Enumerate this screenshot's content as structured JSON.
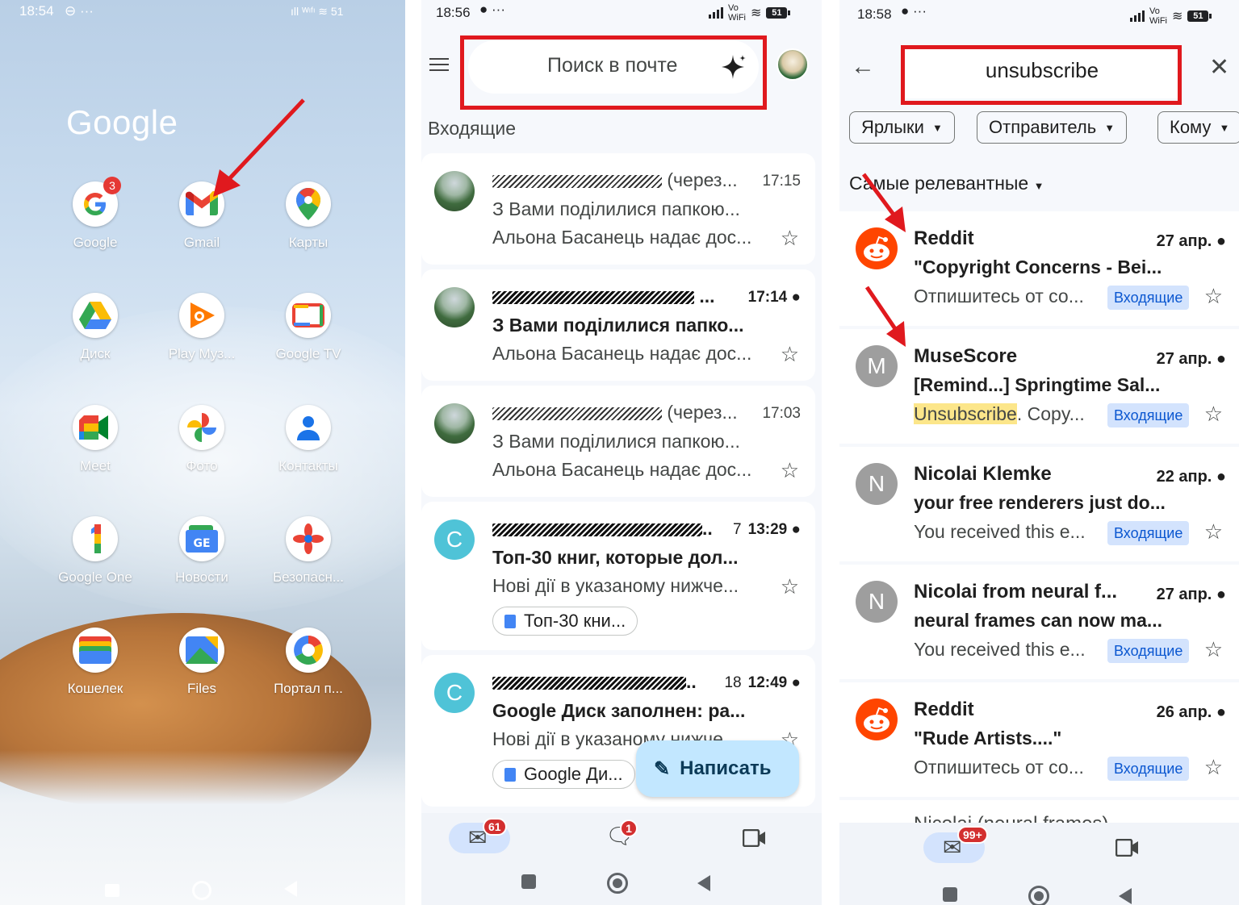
{
  "panel1": {
    "status_time": "18:54",
    "status_dots": "⊖ ···",
    "status_right": "ıll ᵂᶦᶠᶦ ≋ 51",
    "folder_title": "Google",
    "apps": [
      {
        "label": "Google",
        "badge": "3"
      },
      {
        "label": "Gmail"
      },
      {
        "label": "Карты"
      },
      {
        "label": "Диск"
      },
      {
        "label": "Play Муз..."
      },
      {
        "label": "Google TV"
      },
      {
        "label": "Meet"
      },
      {
        "label": "Фото"
      },
      {
        "label": "Контакты"
      },
      {
        "label": "Google One"
      },
      {
        "label": "Новости"
      },
      {
        "label": "Безопасн..."
      },
      {
        "label": "Кошелек"
      },
      {
        "label": "Files"
      },
      {
        "label": "Портал п..."
      }
    ]
  },
  "panel2": {
    "status_time": "18:56",
    "search_placeholder": "Поиск в почте",
    "section_title": "Входящие",
    "emails": [
      {
        "from_suffix": "(через...",
        "time": "17:15",
        "subject": "З Вами поділилися папкою...",
        "snippet": "Альона Басанець надає дос...",
        "unread": false
      },
      {
        "from_suffix": "...",
        "time": "17:14",
        "subject": "З Вами поділилися папко...",
        "snippet": "Альона Басанець надає дос...",
        "unread": true
      },
      {
        "from_suffix": "(через...",
        "time": "17:03",
        "subject": "З Вами поділилися папкою...",
        "snippet": "Альона Басанець надає дос...",
        "unread": false
      },
      {
        "from_suffix": "..",
        "count": "7",
        "time": "13:29",
        "subject": "Топ-30 книг, которые дол...",
        "snippet": "Нові дії в указаному нижче...",
        "chip": "Топ-30 кни...",
        "unread": true,
        "avatar_letter": "C"
      },
      {
        "from_suffix": "..",
        "count": "18",
        "time": "12:49",
        "subject": "Google Диск заполнен: ра...",
        "snippet": "Нові дії в указаному нижче...",
        "chip": "Google Ди...",
        "unread": true,
        "avatar_letter": "C"
      }
    ],
    "compose_label": "Написать",
    "mail_badge": "61",
    "chat_badge": "1"
  },
  "panel3": {
    "status_time": "18:58",
    "search_query": "unsubscribe",
    "filters": [
      "Ярлыки",
      "Отправитель",
      "Кому"
    ],
    "sort_label": "Самые релевантные",
    "results": [
      {
        "from": "Reddit",
        "date": "27 апр.",
        "subject": "\"Copyright Concerns - Bei...",
        "snippet": "Отпишитесь от со...",
        "label": "Входящие",
        "avatar": "reddit"
      },
      {
        "from": "MuseScore",
        "date": "27 апр.",
        "subject": "[Remind...] Springtime Sal...",
        "snippet_hl": "Unsubscribe",
        "snippet_rest": ". Copy...",
        "label": "Входящие",
        "avatar_letter": "M"
      },
      {
        "from": "Nicolai Klemke",
        "date": "22 апр.",
        "subject": "your free renderers just do...",
        "snippet": "You received this e...",
        "label": "Входящие",
        "avatar_letter": "N"
      },
      {
        "from": "Nicolai from neural f...",
        "date": "27 апр.",
        "subject": "neural frames can now ma...",
        "snippet": "You received this e...",
        "label": "Входящие",
        "avatar_letter": "N"
      },
      {
        "from": "Reddit",
        "date": "26 апр.",
        "subject": "\"Rude Artists....\"",
        "snippet": "Отпишитесь от со...",
        "label": "Входящие",
        "avatar": "reddit"
      }
    ],
    "partial_row": "Nicolai (neural frames)",
    "mail_badge": "99+"
  },
  "colors": {
    "annotation_red": "#e0191e",
    "label_bg": "#d3e3fd",
    "compose_bg": "#c2e7ff",
    "highlight": "#fce68a"
  }
}
